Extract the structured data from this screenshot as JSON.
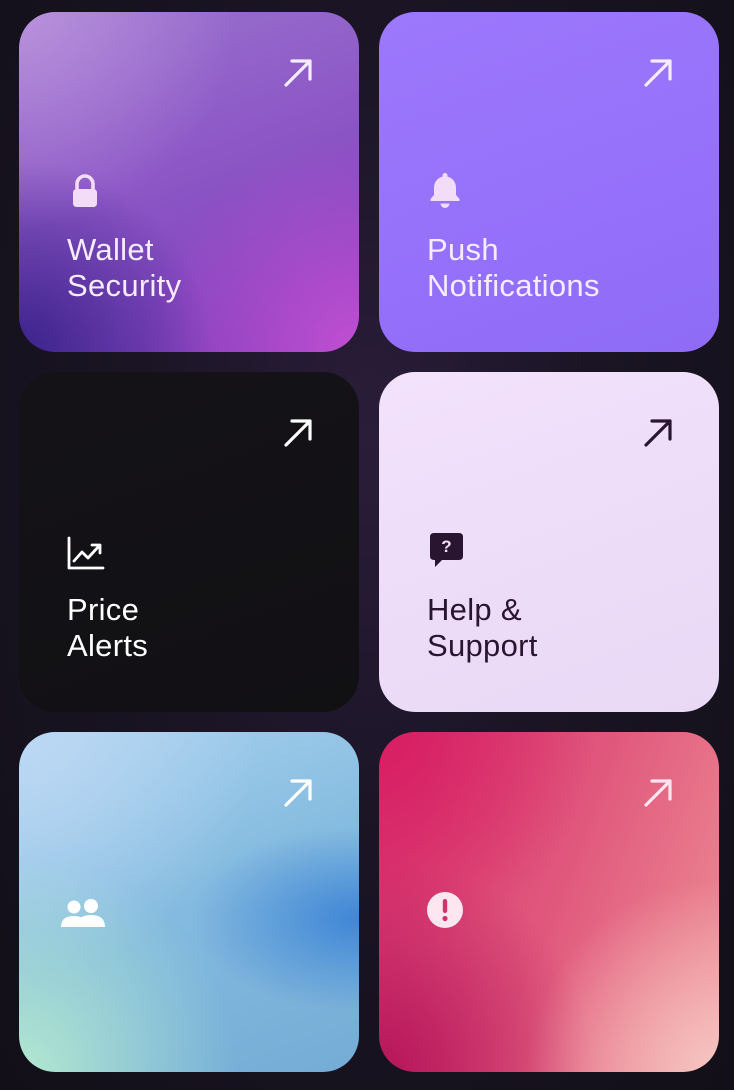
{
  "cards": [
    {
      "id": "wallet-security",
      "lines": [
        "Wallet",
        "Security"
      ],
      "icon": "lock-icon",
      "text_color": "#f5ecff",
      "icon_color": "#f3dcf7"
    },
    {
      "id": "push-notifications",
      "lines": [
        "Push",
        "Notifications"
      ],
      "icon": "bell-icon",
      "text_color": "#f5ecff",
      "icon_color": "#f3dcf7"
    },
    {
      "id": "price-alerts",
      "lines": [
        "Price",
        "Alerts"
      ],
      "icon": "chart-trend-icon",
      "text_color": "#ffffff",
      "icon_color": "#ffffff"
    },
    {
      "id": "help-support",
      "lines": [
        "Help &",
        "Support"
      ],
      "icon": "question-chat-icon",
      "text_color": "#2a1530",
      "icon_color": "#2a1530"
    },
    {
      "id": "community",
      "lines": [],
      "icon": "users-icon",
      "text_color": "#ffffff",
      "icon_color": "#ffffff"
    },
    {
      "id": "report",
      "lines": [],
      "icon": "alert-circle-icon",
      "text_color": "#ffffff",
      "icon_color": "#fde6ef"
    }
  ]
}
